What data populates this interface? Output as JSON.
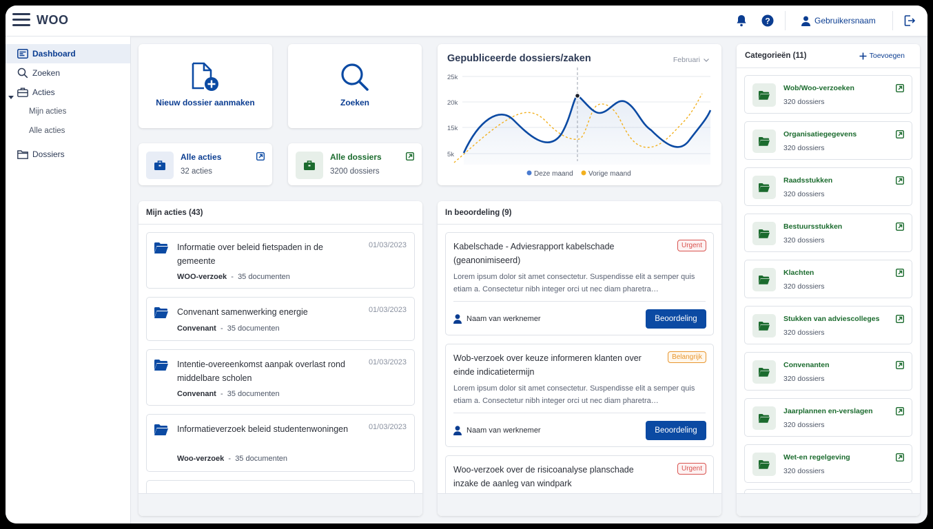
{
  "app": {
    "brand": "WOO",
    "user": "Gebruikersnaam"
  },
  "sidebar": {
    "items": [
      {
        "label": "Dashboard"
      },
      {
        "label": "Zoeken"
      },
      {
        "label": "Acties"
      },
      {
        "label": "Mijn acties"
      },
      {
        "label": "Alle acties"
      },
      {
        "label": "Dossiers"
      }
    ]
  },
  "quick": {
    "new_dossier": "Nieuw dossier aanmaken",
    "search": "Zoeken",
    "all_actions": {
      "title": "Alle acties",
      "count": "32 acties"
    },
    "all_dossiers": {
      "title": "Alle dossiers",
      "count": "3200 dossiers"
    }
  },
  "chart": {
    "title": "Gepubliceerde dossiers/zaken",
    "month": "Februari",
    "yticks": [
      "25k",
      "20k",
      "15k",
      "5k"
    ]
  },
  "chart_data": {
    "type": "line",
    "title": "Gepubliceerde dossiers/zaken",
    "yticks": [
      "25k",
      "20k",
      "15k",
      "5k"
    ],
    "series": [
      {
        "name": "Deze maand",
        "color": "#0b4aa3"
      },
      {
        "name": "Vorige maand",
        "color": "#f2b01e"
      }
    ]
  },
  "my_actions": {
    "title": "Mijn acties (43)",
    "items": [
      {
        "title": "Informatie over beleid fietspaden in de gemeente",
        "date": "01/03/2023",
        "type": "WOO-verzoek",
        "docs": "35 documenten"
      },
      {
        "title": "Convenant samenwerking energie",
        "date": "01/03/2023",
        "type": "Convenant",
        "docs": "35 documenten"
      },
      {
        "title": "Intentie-overeenkomst aanpak overlast rond middelbare scholen",
        "date": "01/03/2023",
        "type": "Convenant",
        "docs": "35 documenten"
      },
      {
        "title": "Informatieverzoek beleid studentenwoningen",
        "date": "01/03/2023",
        "type": "Woo-verzoek",
        "docs": "35 documenten"
      }
    ],
    "separator": "-"
  },
  "review": {
    "title": "In beoordeling (9)",
    "items": [
      {
        "title": "Kabelschade - Adviesrapport kabelschade (geanonimiseerd)",
        "badge": "Urgent",
        "desc": "Lorem ipsum dolor sit amet consectetur. Suspendisse elit a semper quis etiam a. Consectetur nibh integer orci ut nec diam pharetra…",
        "employee": "Naam van werknemer",
        "button": "Beoordeling"
      },
      {
        "title": "Wob-verzoek over keuze informeren klanten over einde indicatietermijn",
        "badge": "Belangrijk",
        "desc": "Lorem ipsum dolor sit amet consectetur. Suspendisse elit a semper quis etiam a. Consectetur nibh integer orci ut nec diam pharetra…",
        "employee": "Naam van werknemer",
        "button": "Beoordeling"
      },
      {
        "title": "Woo-verzoek over de risicoanalyse planschade inzake de aanleg van windpark",
        "badge": "Urgent"
      }
    ]
  },
  "categories": {
    "title": "Categorieën (11)",
    "add": "Toevoegen",
    "items": [
      {
        "name": "Wob/Woo-verzoeken",
        "count": "320 dossiers"
      },
      {
        "name": "Organisatiegegevens",
        "count": "320 dossiers"
      },
      {
        "name": "Raadsstukken",
        "count": "320 dossiers"
      },
      {
        "name": "Bestuursstukken",
        "count": "320 dossiers"
      },
      {
        "name": "Klachten",
        "count": "320 dossiers"
      },
      {
        "name": "Stukken van adviescolleges",
        "count": "320 dossiers"
      },
      {
        "name": "Convenanten",
        "count": "320 dossiers"
      },
      {
        "name": "Jaarplannen en-verslagen",
        "count": "320 dossiers"
      },
      {
        "name": "Wet-en regelgeving",
        "count": "320 dossiers"
      }
    ]
  },
  "colors": {
    "primary": "#0b4aa3",
    "green": "#1b6b2e",
    "urgent": "#d9534f",
    "important": "#e8962e"
  }
}
